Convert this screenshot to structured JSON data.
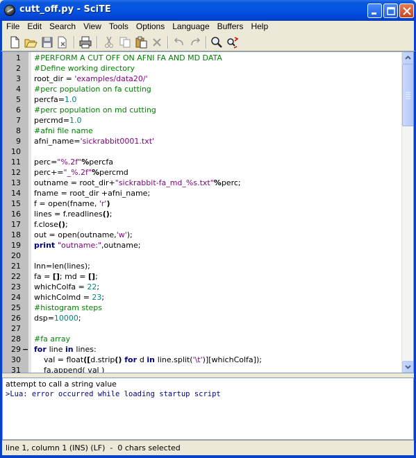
{
  "window": {
    "title": "cutt_off.py - SciTE"
  },
  "menu": [
    "File",
    "Edit",
    "Search",
    "View",
    "Tools",
    "Options",
    "Language",
    "Buffers",
    "Help"
  ],
  "toolbar_icons": [
    "new-icon",
    "open-icon",
    "save-icon",
    "close-file-icon",
    "print-icon",
    "cut-icon",
    "copy-icon",
    "paste-icon",
    "delete-icon",
    "undo-icon",
    "redo-icon",
    "find-icon",
    "replace-icon"
  ],
  "editor": {
    "lines": [
      {
        "n": "1",
        "tokens": [
          {
            "t": "#PERFORM A CUT OFF ON AFNI FA AND MD DATA",
            "c": "comment"
          }
        ]
      },
      {
        "n": "2",
        "tokens": [
          {
            "t": "#Define working directory",
            "c": "comment"
          }
        ]
      },
      {
        "n": "3",
        "tokens": [
          {
            "t": "root_dir = ",
            "c": "default"
          },
          {
            "t": "'examples/data20/'",
            "c": "string"
          }
        ]
      },
      {
        "n": "4",
        "tokens": [
          {
            "t": "#perc population on fa cutting",
            "c": "comment"
          }
        ]
      },
      {
        "n": "5",
        "tokens": [
          {
            "t": "percfa=",
            "c": "default"
          },
          {
            "t": "1.0",
            "c": "number"
          }
        ]
      },
      {
        "n": "6",
        "tokens": [
          {
            "t": "#perc population on md cutting",
            "c": "comment"
          }
        ]
      },
      {
        "n": "7",
        "tokens": [
          {
            "t": "percmd=",
            "c": "default"
          },
          {
            "t": "1.0",
            "c": "number"
          }
        ]
      },
      {
        "n": "8",
        "tokens": [
          {
            "t": "#afni file name",
            "c": "comment"
          }
        ]
      },
      {
        "n": "9",
        "tokens": [
          {
            "t": "afni_name=",
            "c": "default"
          },
          {
            "t": "'sickrabbit0001.txt'",
            "c": "string"
          }
        ]
      },
      {
        "n": "10",
        "tokens": []
      },
      {
        "n": "11",
        "tokens": [
          {
            "t": "perc=",
            "c": "default"
          },
          {
            "t": "\"%.2f\"",
            "c": "string"
          },
          {
            "t": "%",
            "c": "op"
          },
          {
            "t": "percfa",
            "c": "default"
          }
        ]
      },
      {
        "n": "12",
        "tokens": [
          {
            "t": "perc+=",
            "c": "default"
          },
          {
            "t": "\"_%.2f\"",
            "c": "string"
          },
          {
            "t": "%",
            "c": "op"
          },
          {
            "t": "percmd",
            "c": "default"
          }
        ]
      },
      {
        "n": "13",
        "tokens": [
          {
            "t": "outname = root_dir+",
            "c": "default"
          },
          {
            "t": "\"sickrabbit-fa_md_%s.txt\"",
            "c": "string"
          },
          {
            "t": "%",
            "c": "op"
          },
          {
            "t": "perc;",
            "c": "default"
          }
        ]
      },
      {
        "n": "14",
        "tokens": [
          {
            "t": "fname = root_dir +afni_name;",
            "c": "default"
          }
        ]
      },
      {
        "n": "15",
        "tokens": [
          {
            "t": "f = open(fname, ",
            "c": "default"
          },
          {
            "t": "'r'",
            "c": "string"
          },
          {
            "t": ")",
            "c": "op"
          }
        ]
      },
      {
        "n": "16",
        "tokens": [
          {
            "t": "lines = f.readlines",
            "c": "default"
          },
          {
            "t": "()",
            "c": "op"
          },
          {
            "t": ";",
            "c": "default"
          }
        ]
      },
      {
        "n": "17",
        "tokens": [
          {
            "t": "f.close",
            "c": "default"
          },
          {
            "t": "()",
            "c": "op"
          },
          {
            "t": ";",
            "c": "default"
          }
        ]
      },
      {
        "n": "18",
        "tokens": [
          {
            "t": "out = open(outname,",
            "c": "default"
          },
          {
            "t": "'w'",
            "c": "string"
          },
          {
            "t": ");",
            "c": "default"
          }
        ]
      },
      {
        "n": "19",
        "tokens": [
          {
            "t": "print ",
            "c": "keyword"
          },
          {
            "t": "\"outname:\"",
            "c": "string"
          },
          {
            "t": ",outname;",
            "c": "default"
          }
        ]
      },
      {
        "n": "20",
        "tokens": []
      },
      {
        "n": "21",
        "tokens": [
          {
            "t": "lnn=len(lines);",
            "c": "default"
          }
        ]
      },
      {
        "n": "22",
        "tokens": [
          {
            "t": "fa = ",
            "c": "default"
          },
          {
            "t": "[]",
            "c": "op"
          },
          {
            "t": "; md = ",
            "c": "default"
          },
          {
            "t": "[]",
            "c": "op"
          },
          {
            "t": ";",
            "c": "default"
          }
        ]
      },
      {
        "n": "23",
        "tokens": [
          {
            "t": "whichColfa = ",
            "c": "default"
          },
          {
            "t": "22",
            "c": "number"
          },
          {
            "t": ";",
            "c": "default"
          }
        ]
      },
      {
        "n": "24",
        "tokens": [
          {
            "t": "whichColmd = ",
            "c": "default"
          },
          {
            "t": "23",
            "c": "number"
          },
          {
            "t": ";",
            "c": "default"
          }
        ]
      },
      {
        "n": "25",
        "tokens": [
          {
            "t": "#histogram steps",
            "c": "comment"
          }
        ]
      },
      {
        "n": "26",
        "tokens": [
          {
            "t": "dsp=",
            "c": "default"
          },
          {
            "t": "10000",
            "c": "number"
          },
          {
            "t": ";",
            "c": "default"
          }
        ]
      },
      {
        "n": "27",
        "tokens": []
      },
      {
        "n": "28",
        "tokens": [
          {
            "t": "#fa array",
            "c": "comment"
          }
        ]
      },
      {
        "n": "29",
        "fold": "−",
        "tokens": [
          {
            "t": "for ",
            "c": "keyword"
          },
          {
            "t": "line ",
            "c": "default"
          },
          {
            "t": "in ",
            "c": "keyword"
          },
          {
            "t": "lines:",
            "c": "default"
          }
        ]
      },
      {
        "n": "30",
        "tokens": [
          {
            "t": "    val = float",
            "c": "default"
          },
          {
            "t": "([",
            "c": "op"
          },
          {
            "t": "d.strip",
            "c": "default"
          },
          {
            "t": "() ",
            "c": "op"
          },
          {
            "t": "for ",
            "c": "keyword"
          },
          {
            "t": "d ",
            "c": "default"
          },
          {
            "t": "in ",
            "c": "keyword"
          },
          {
            "t": "line.split(",
            "c": "default"
          },
          {
            "t": "'\\t'",
            "c": "string"
          },
          {
            "t": ")][whichColfa]);",
            "c": "default"
          }
        ]
      },
      {
        "n": "31",
        "tokens": [
          {
            "t": "    fa.append( val )",
            "c": "default"
          }
        ]
      }
    ]
  },
  "output": {
    "lines": [
      {
        "t": "attempt to call a string value",
        "c": "cmd"
      },
      {
        "t": ">Lua: error occurred while loading startup script",
        "c": "err"
      }
    ]
  },
  "status": {
    "text": "line 1, column 1 (INS) (LF)  -  0 chars selected"
  }
}
